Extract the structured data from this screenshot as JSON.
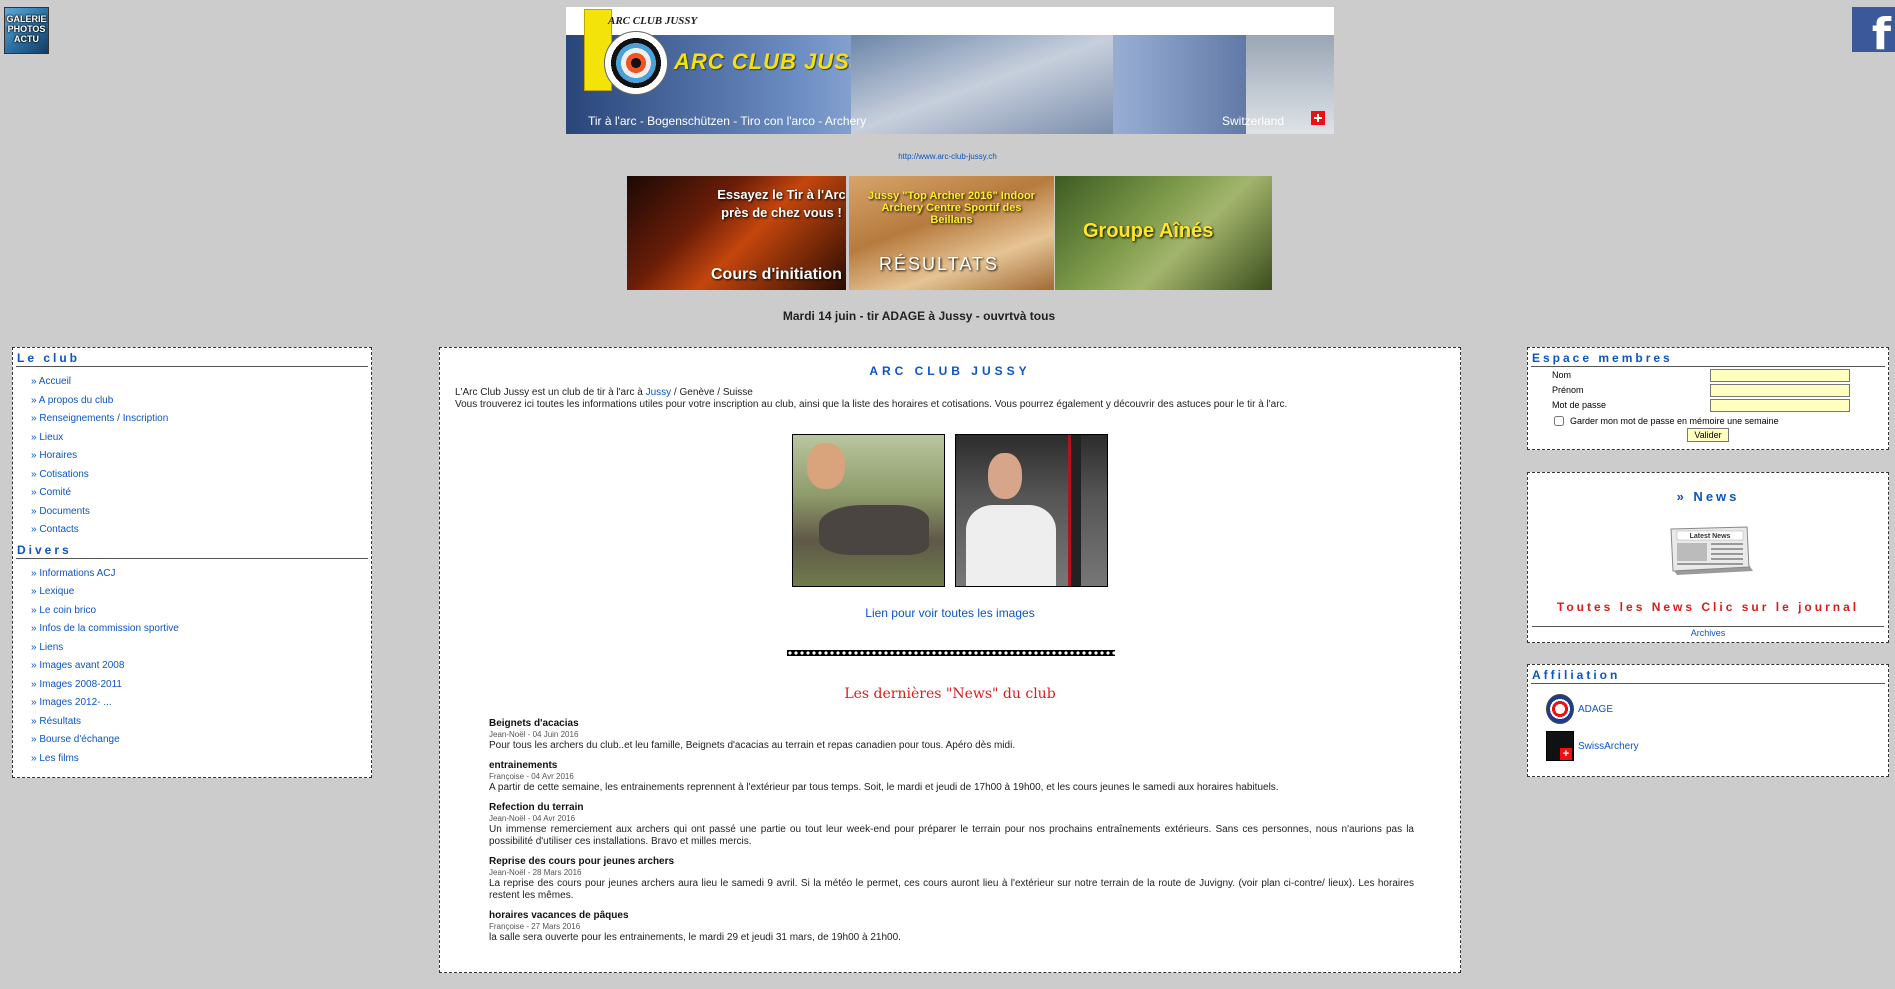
{
  "topbar": {
    "gallery_icon_text": "GALERIE PHOTOS ACTU",
    "facebook_glyph": "f"
  },
  "banner": {
    "small_title": "ARC CLUB JUSSY",
    "title": "ARC CLUB JUSSY",
    "subtitle": "Tir à l'arc - Bogenschützen - Tiro con l'arco - Archery",
    "country": "Switzerland"
  },
  "site_url": "http://www.arc-club-jussy.ch",
  "promos": [
    {
      "line1": "Essayez le Tir à l'Arc près de chez vous !",
      "line2": "Cours d'initiation"
    },
    {
      "line1": "Jussy \"Top Archer 2016\" Indoor Archery Centre Sportif des Beillans",
      "line2": "RÉSULTATS"
    },
    {
      "line1": "Groupe Aînés"
    }
  ],
  "announcement": "Mardi 14 juin - tir ADAGE à Jussy - ouvrtvà tous",
  "left_nav": {
    "section1_title": "Le club",
    "section1_items": [
      "Accueil",
      "A propos du club",
      "Renseignements / Inscription",
      "Lieux",
      "Horaires",
      "Cotisations",
      "Comité",
      "Documents",
      "Contacts"
    ],
    "section2_title": "Divers",
    "section2_items": [
      "Informations ACJ",
      "Lexique",
      "Le coin brico",
      "Infos de la commission sportive",
      "Liens",
      "Images avant 2008",
      "Images 2008-2011",
      "Images 2012- ...",
      "Résultats",
      "Bourse d'échange",
      "Les films"
    ]
  },
  "main": {
    "title": "ARC CLUB JUSSY",
    "intro_line1_before": "L'Arc Club Jussy est un club de tir à l'arc à ",
    "intro_link": "Jussy",
    "intro_line1_after": " / Genève / Suisse",
    "intro_line2": "Vous trouverez ici toutes les informations utiles pour votre inscription au club, ainsi que la liste des horaires et cotisations. Vous pourrez également y découvrir des astuces pour le tir à l'arc.",
    "images_link": "Lien pour voir toutes les images",
    "news_heading": "Les dernières \"News\" du club",
    "news": [
      {
        "title": "Beignets d'acacias",
        "meta": "Jean-Noël - 04 Juin 2016",
        "body": "Pour tous les archers du club..et leu famille, Beignets d'acacias au terrain et repas canadien pour tous. Apéro dès midi."
      },
      {
        "title": "entrainements",
        "meta": "Françoise - 04 Avr 2016",
        "body": "A partir de cette semaine, les entrainements reprennent à l'extérieur par tous temps. Soit, le mardi et jeudi de 17h00 à 19h00, et les cours jeunes le samedi aux horaires habituels."
      },
      {
        "title": "Refection du terrain",
        "meta": "Jean-Noël - 04 Avr 2016",
        "body": "Un immense remerciement aux archers qui ont passé une partie ou tout leur week-end pour préparer le terrain pour nos prochains entraînements extérieurs. Sans ces personnes, nous n'aurions pas la possibilité d'utiliser ces installations. Bravo et milles mercis."
      },
      {
        "title": "Reprise des cours pour jeunes archers",
        "meta": "Jean-Noël - 28 Mars 2016",
        "body": "La reprise des cours pour jeunes archers aura lieu le samedi 9 avril. Si la météo le permet, ces cours auront lieu à l'extérieur sur notre terrain de la route de Juvigny. (voir plan ci-contre/ lieux). Les horaires restent les mêmes."
      },
      {
        "title": "horaires vacances de pâques",
        "meta": "Françoise - 27 Mars 2016",
        "body": "la salle sera ouverte pour les entrainements, le mardi 29 et jeudi 31 mars, de 19h00 à 21h00."
      }
    ]
  },
  "members": {
    "title": "Espace membres",
    "name_label": "Nom",
    "firstname_label": "Prénom",
    "password_label": "Mot de passe",
    "remember_label": "Garder mon mot de passe en mémoire une semaine",
    "submit_label": "Valider",
    "name_value": "",
    "firstname_value": "",
    "password_value": ""
  },
  "news_box": {
    "title": "» News",
    "icon_text": "Latest News",
    "click_text": "Toutes les News Clic sur le journal",
    "archives": "Archives"
  },
  "affiliation": {
    "title": "Affiliation",
    "items": [
      "ADAGE",
      "SwissArchery"
    ]
  }
}
